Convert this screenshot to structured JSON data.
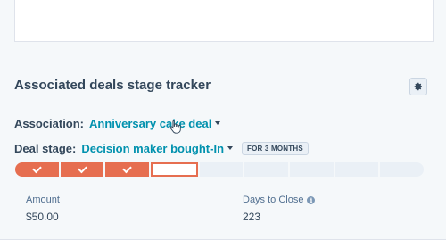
{
  "card": {
    "title": "Associated deals stage tracker"
  },
  "association": {
    "label": "Association:",
    "value": "Anniversary cake deal"
  },
  "deal_stage": {
    "label": "Deal stage:",
    "value": "Decision maker bought-In",
    "duration_badge": "FOR 3 MONTHS"
  },
  "stage_tracker": {
    "total_stages": 9,
    "completed_stages": 3,
    "current_stage_index": 4,
    "accent_color": "#e66e50"
  },
  "properties": {
    "amount": {
      "label": "Amount",
      "value": "$50.00"
    },
    "days_to_close": {
      "label": "Days to Close",
      "value": "223"
    }
  },
  "icons": {
    "settings": "gear-icon",
    "dropdown": "caret-down-icon",
    "info": "info-icon",
    "pointer": "hand-pointer-icon",
    "completed": "check-icon"
  }
}
